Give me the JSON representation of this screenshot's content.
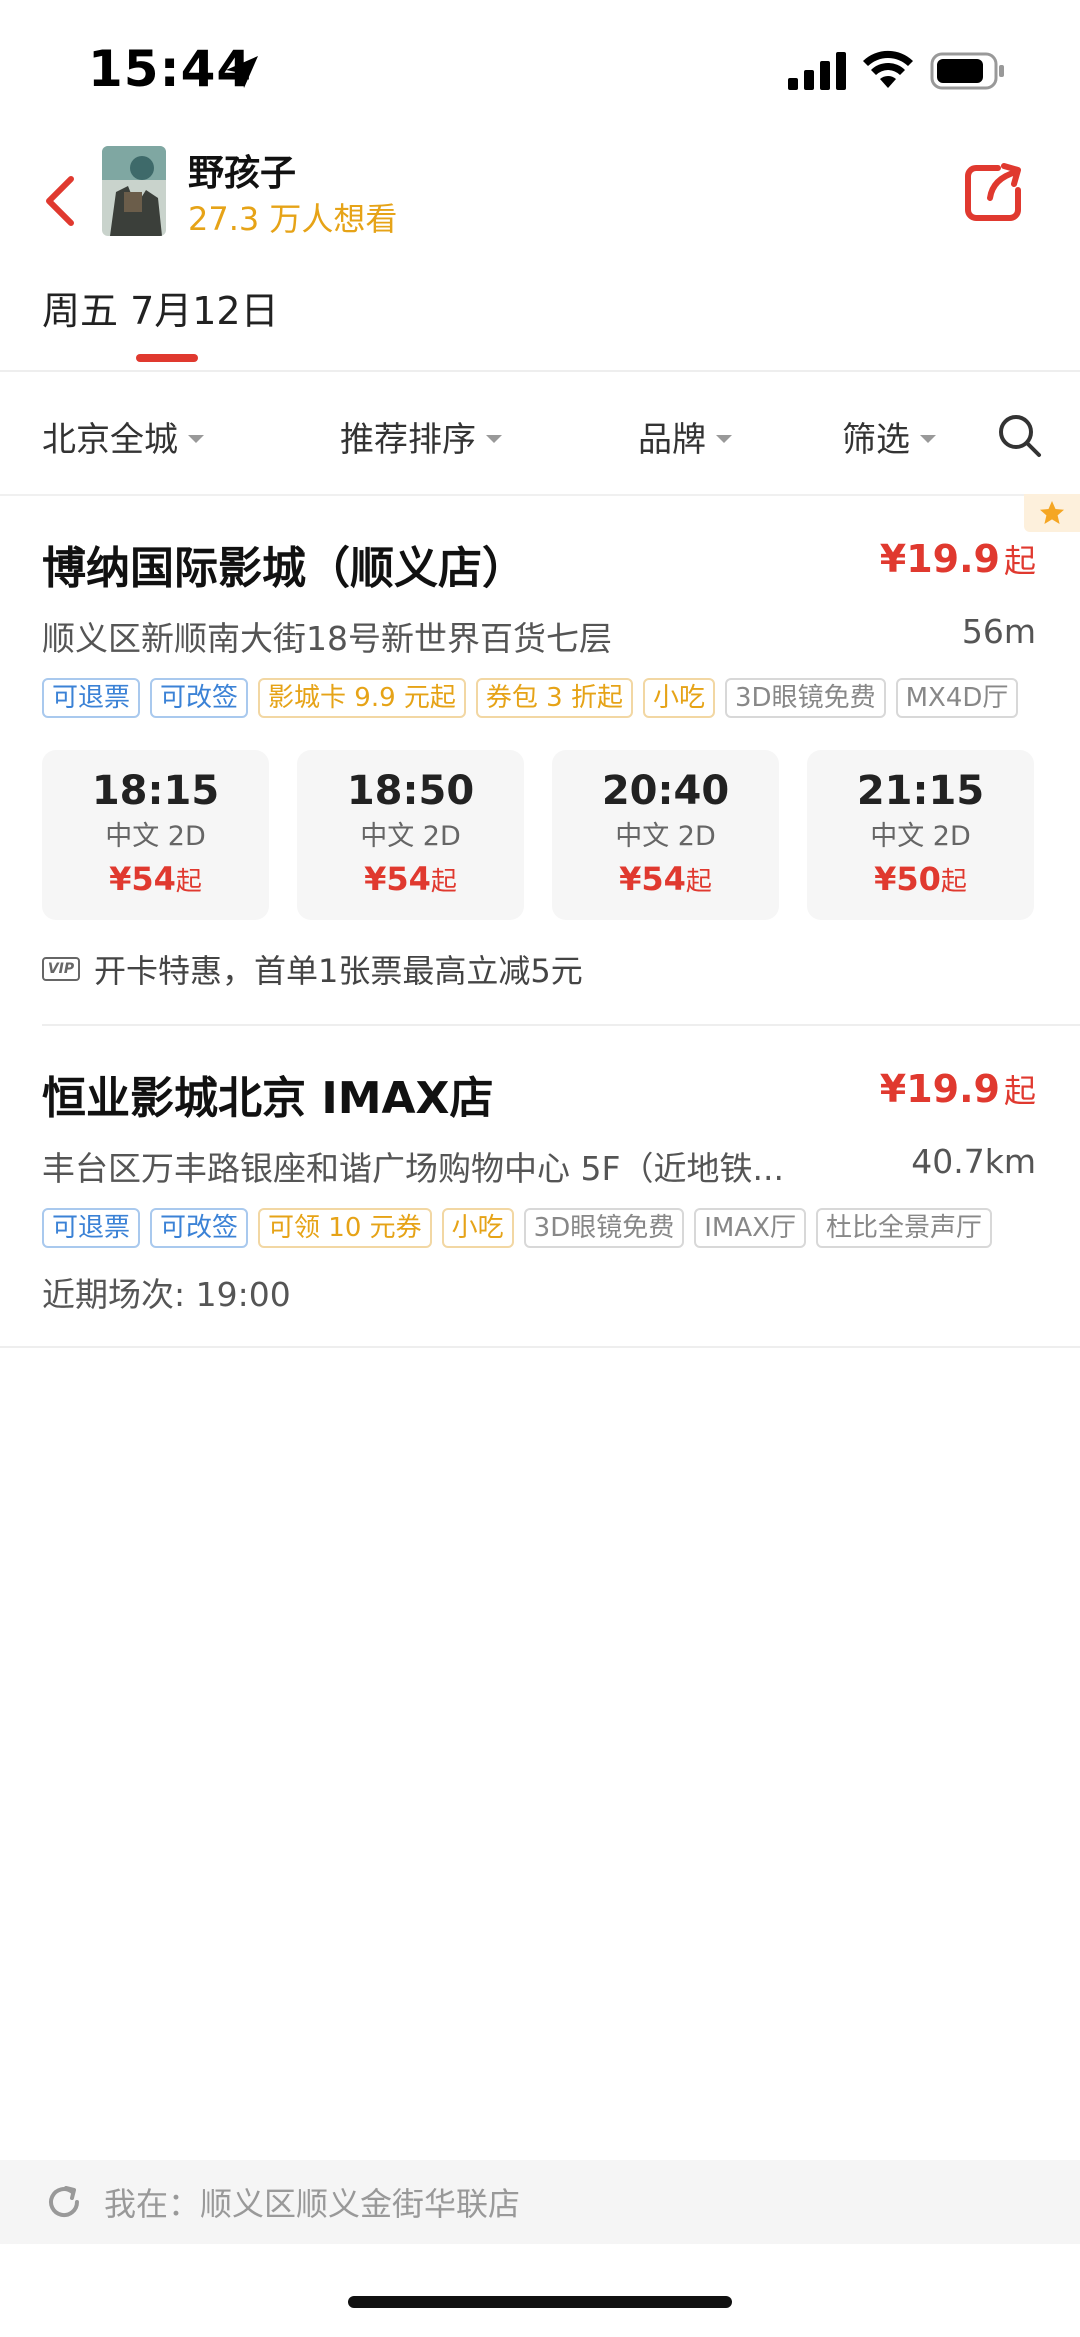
{
  "status_bar": {
    "time": "15:44"
  },
  "header": {
    "movie_title": "野孩子",
    "want_count": "27.3 万人想看"
  },
  "date_tab": {
    "label": "周五 7月12日"
  },
  "filters": [
    {
      "label": "北京全城"
    },
    {
      "label": "推荐排序"
    },
    {
      "label": "品牌"
    },
    {
      "label": "筛选"
    }
  ],
  "cinemas": [
    {
      "name": "博纳国际影城（顺义店）",
      "price": "¥19.9",
      "price_suffix": "起",
      "address": "顺义区新顺南大街18号新世界百货七层",
      "distance": "56m",
      "tags": [
        {
          "text": "可退票",
          "color": "blue"
        },
        {
          "text": "可改签",
          "color": "blue"
        },
        {
          "text": "影城卡 9.9 元起",
          "color": "orange"
        },
        {
          "text": "券包 3 折起",
          "color": "orange"
        },
        {
          "text": "小吃",
          "color": "orange"
        },
        {
          "text": "3D眼镜免费",
          "color": "gray"
        },
        {
          "text": "MX4D厅",
          "color": "gray"
        }
      ],
      "showtimes": [
        {
          "time": "18:15",
          "lang": "中文 2D",
          "price": "¥54",
          "suffix": "起"
        },
        {
          "time": "18:50",
          "lang": "中文 2D",
          "price": "¥54",
          "suffix": "起"
        },
        {
          "time": "20:40",
          "lang": "中文 2D",
          "price": "¥54",
          "suffix": "起"
        },
        {
          "time": "21:15",
          "lang": "中文 2D",
          "price": "¥50",
          "suffix": "起"
        }
      ],
      "promo": "开卡特惠，首单1张票最高立减5元",
      "promo_icon": "VIP"
    },
    {
      "name": "恒业影城北京 IMAX店",
      "price": "¥19.9",
      "price_suffix": "起",
      "address": "丰台区万丰路银座和谐广场购物中心 5F（近地铁...",
      "distance": "40.7km",
      "tags": [
        {
          "text": "可退票",
          "color": "blue"
        },
        {
          "text": "可改签",
          "color": "blue"
        },
        {
          "text": "可领 10 元券",
          "color": "orange"
        },
        {
          "text": "小吃",
          "color": "orange"
        },
        {
          "text": "3D眼镜免费",
          "color": "gray"
        },
        {
          "text": "IMAX厅",
          "color": "gray"
        },
        {
          "text": "杜比全景声厅",
          "color": "gray"
        }
      ],
      "recent": "近期场次: 19:00"
    }
  ],
  "location_bar": {
    "text": "我在：顺义区顺义金街华联店"
  },
  "colors": {
    "accent": "#e0392f",
    "gold": "#e6a317",
    "tag_blue": "#3b82d6"
  }
}
